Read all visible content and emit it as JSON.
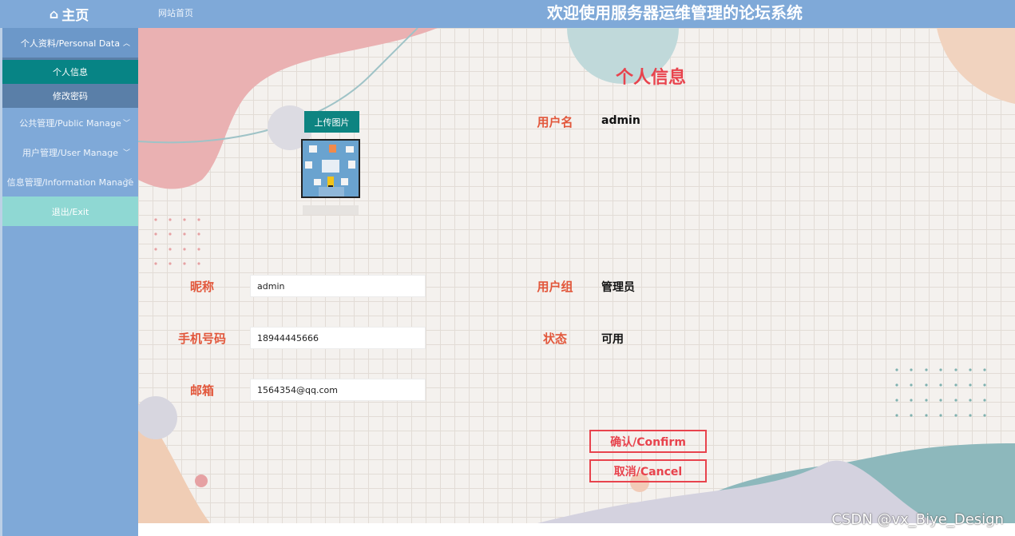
{
  "header": {
    "home_label": "主页",
    "site_link": "网站首页",
    "system_title": "欢迎使用服务器运维管理的论坛系统"
  },
  "sidebar": {
    "groups": [
      {
        "label": "个人资料/Personal Data",
        "expanded": true
      },
      {
        "label": "公共管理/Public Manage"
      },
      {
        "label": "用户管理/User Manage"
      },
      {
        "label": "信息管理/Information Manage"
      }
    ],
    "sub_items": [
      {
        "label": "个人信息",
        "active": true
      },
      {
        "label": "修改密码"
      }
    ],
    "exit_label": "退出/Exit"
  },
  "profile": {
    "page_title": "个人信息",
    "upload_label": "上传图片",
    "fields": {
      "nickname": {
        "label": "昵称",
        "value": "admin"
      },
      "phone": {
        "label": "手机号码",
        "value": "18944445666"
      },
      "email": {
        "label": "邮箱",
        "value": "1564354@qq.com"
      }
    },
    "info": {
      "username": {
        "label": "用户名",
        "value": "admin"
      },
      "group": {
        "label": "用户组",
        "value": "管理员"
      },
      "status": {
        "label": "状态",
        "value": "可用"
      }
    },
    "confirm_label": "确认/Confirm",
    "cancel_label": "取消/Cancel"
  },
  "watermark": "CSDN @vx_Biye_Design",
  "colors": {
    "topbar": "#7fa9d8",
    "active_item": "#078485",
    "accent_red": "#e8434d",
    "label_orange": "#e2573b"
  }
}
